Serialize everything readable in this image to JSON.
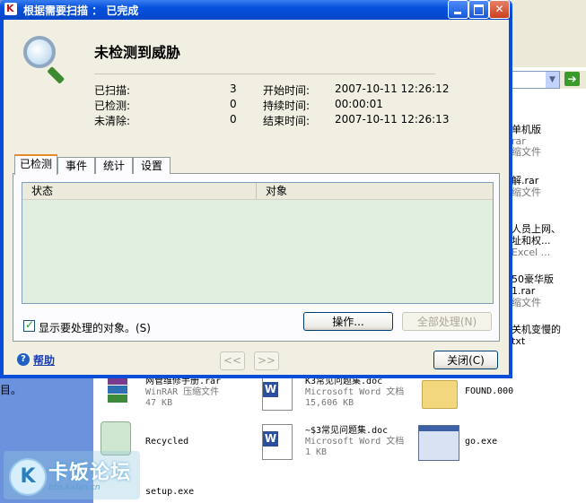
{
  "window": {
    "title": "根据需要扫描 ： 已完成",
    "controls": {
      "minimize": "minimize-icon",
      "maximize": "maximize-icon",
      "close": "close-icon"
    }
  },
  "summary": {
    "status": "未检测到威胁",
    "stats": [
      {
        "label": "已扫描:",
        "value": "3"
      },
      {
        "label": "已检测:",
        "value": "0"
      },
      {
        "label": "未清除:",
        "value": "0"
      }
    ],
    "times": [
      {
        "label": "开始时间:",
        "value": "2007-10-11 12:26:12"
      },
      {
        "label": "持续时间:",
        "value": "00:00:01"
      },
      {
        "label": "结束时间:",
        "value": "2007-10-11 12:26:13"
      }
    ]
  },
  "tabs": [
    {
      "label": "已检测",
      "active": true
    },
    {
      "label": "事件",
      "active": false
    },
    {
      "label": "统计",
      "active": false
    },
    {
      "label": "设置",
      "active": false
    }
  ],
  "table": {
    "columns": [
      "状态",
      "对象"
    ],
    "rows": []
  },
  "options": {
    "show_objects_label": "显示要处理的对象。(S)",
    "show_objects_checked": true
  },
  "buttons": {
    "action": "操作...",
    "process_all": "全部处理(N)",
    "back": "<<",
    "forward": ">>",
    "close": "关闭(C)",
    "help": "帮助"
  },
  "background": {
    "left_text": "目。",
    "right_items": [
      {
        "name": "单机版",
        "sub": "rar"
      },
      {
        "name": "缩文件",
        "sub": ""
      },
      {
        "name": "解.rar",
        "sub": "缩文件"
      },
      {
        "name": "人员上网、",
        "sub": "址和权..."
      },
      {
        "name": "Excel ...",
        "sub": ""
      },
      {
        "name": "50豪华版",
        "sub": "1.rar"
      },
      {
        "name": "缩文件",
        "sub": ""
      },
      {
        "name": "关机变慢的",
        "sub": "txt"
      }
    ],
    "files": [
      {
        "name": "网管维修手册.rar",
        "type": "WinRAR 压缩文件",
        "size": "47 KB"
      },
      {
        "name": "K3常见问题集.doc",
        "type": "Microsoft Word 文档",
        "size": "15,606 KB"
      },
      {
        "name": "FOUND.000",
        "type": "",
        "size": ""
      },
      {
        "name": "Recycled",
        "type": "",
        "size": ""
      },
      {
        "name": "~$3常见问题集.doc",
        "type": "Microsoft Word 文档",
        "size": "1 KB"
      },
      {
        "name": "go.exe",
        "type": "",
        "size": ""
      },
      {
        "name": "setup.exe",
        "type": "",
        "size": ""
      }
    ],
    "watermark": {
      "title": "卡饭论坛",
      "sub": "bbs.kafan.cn"
    }
  }
}
